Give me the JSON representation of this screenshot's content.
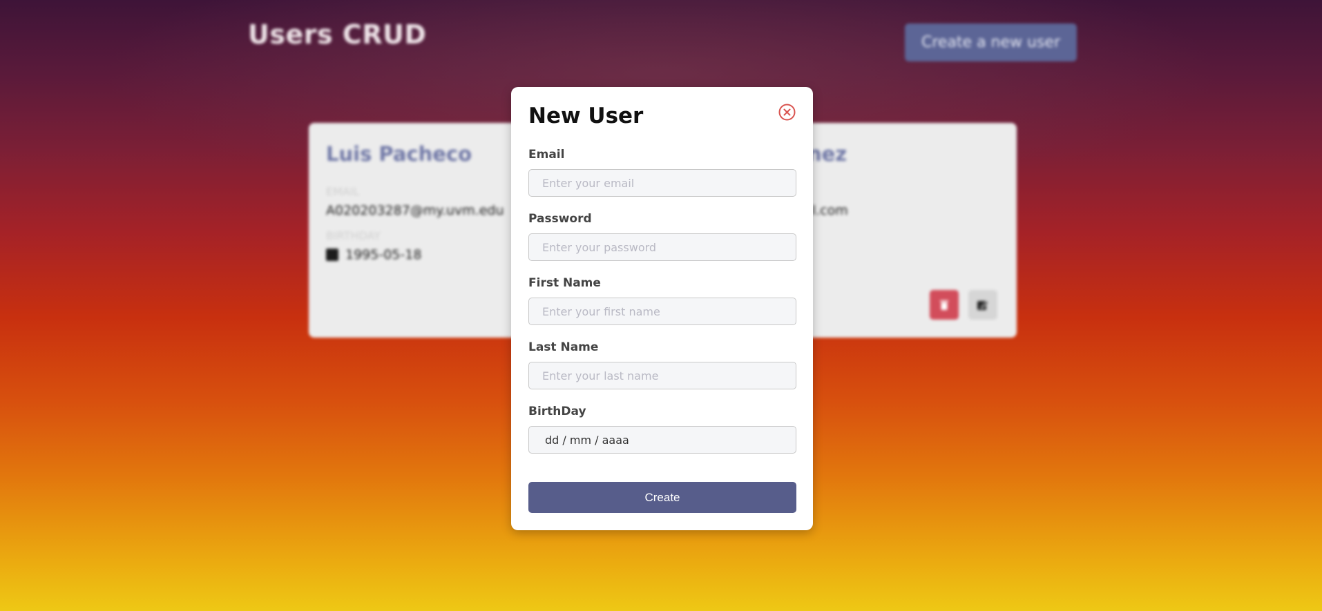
{
  "page": {
    "title": "Users CRUD",
    "create_button_label": "Create a new user"
  },
  "users": [
    {
      "name": "Luis Pacheco",
      "email_label": "EMAIL",
      "email": "A020203287@my.uvm.edu",
      "birthday_label": "BIRTHDAY",
      "birthday": "1995-05-18"
    },
    {
      "name": "ínez",
      "email": "ail.com"
    }
  ],
  "modal": {
    "title": "New User",
    "close_icon": "close-circle-icon",
    "fields": {
      "email": {
        "label": "Email",
        "placeholder": "Enter your email"
      },
      "password": {
        "label": "Password",
        "placeholder": "Enter your password"
      },
      "first_name": {
        "label": "First Name",
        "placeholder": "Enter your first name"
      },
      "last_name": {
        "label": "Last Name",
        "placeholder": "Enter your last name"
      },
      "birthday": {
        "label": "BirthDay",
        "placeholder": "dd / mm / aaaa"
      }
    },
    "submit_label": "Create"
  },
  "colors": {
    "accent": "#575d8b",
    "danger": "#d24d5b",
    "close_icon": "#d9534f"
  }
}
